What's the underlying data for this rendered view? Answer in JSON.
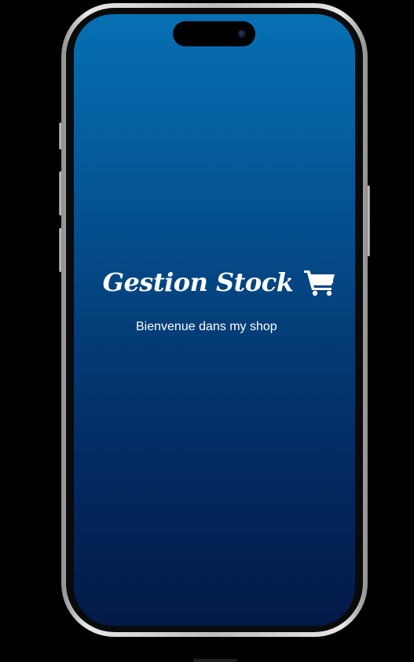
{
  "splash": {
    "title": "Gestion Stock",
    "title_icon": "shopping-cart-icon",
    "subtitle": "Bienvenue dans my shop"
  },
  "theme": {
    "gradient_top": "#0670b3",
    "gradient_bottom": "#031a48",
    "text_color": "#ffffff"
  }
}
